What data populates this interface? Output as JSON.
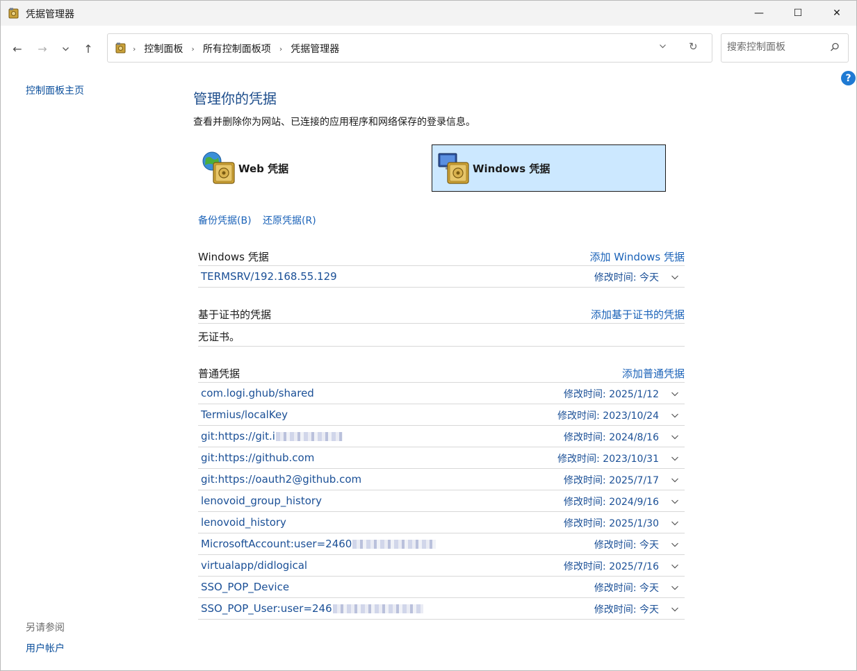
{
  "window": {
    "title": "凭据管理器",
    "buttons": {
      "minimize": "—",
      "maximize": "☐",
      "close": "✕"
    }
  },
  "nav": {
    "breadcrumb": [
      "控制面板",
      "所有控制面板项",
      "凭据管理器"
    ],
    "search_placeholder": "搜索控制面板"
  },
  "sidebar": {
    "home_link": "控制面板主页",
    "see_also_label": "另请参阅",
    "user_accounts_link": "用户帐户"
  },
  "main": {
    "title": "管理你的凭据",
    "description": "查看并删除你为网站、已连接的应用程序和网络保存的登录信息。",
    "tiles": {
      "web": "Web 凭据",
      "windows": "Windows 凭据"
    },
    "actions": {
      "backup": "备份凭据(B)",
      "restore": "还原凭据(R)"
    }
  },
  "sections": {
    "windows": {
      "title": "Windows 凭据",
      "add_link": "添加 Windows 凭据",
      "items": [
        {
          "name": "TERMSRV/192.168.55.129",
          "modified": "修改时间:  今天"
        }
      ]
    },
    "certificate": {
      "title": "基于证书的凭据",
      "add_link": "添加基于证书的凭据",
      "empty_text": "无证书。"
    },
    "generic": {
      "title": "普通凭据",
      "add_link": "添加普通凭据",
      "items": [
        {
          "name": "com.logi.ghub/shared",
          "modified": "修改时间:  2025/1/12"
        },
        {
          "name": "Termius/localKey",
          "modified": "修改时间:  2023/10/24"
        },
        {
          "name": "git:https://git.i",
          "modified": "修改时间:  2024/8/16"
        },
        {
          "name": "git:https://github.com",
          "modified": "修改时间:  2023/10/31"
        },
        {
          "name": "git:https://oauth2@github.com",
          "modified": "修改时间:  2025/7/17"
        },
        {
          "name": "lenovoid_group_history",
          "modified": "修改时间:  2024/9/16"
        },
        {
          "name": "lenovoid_history",
          "modified": "修改时间:  2025/1/30"
        },
        {
          "name": "MicrosoftAccount:user=2460",
          "modified": "修改时间:  今天"
        },
        {
          "name": "virtualapp/didlogical",
          "modified": "修改时间:  2025/7/16"
        },
        {
          "name": "SSO_POP_Device",
          "modified": "修改时间:  今天"
        },
        {
          "name": "SSO_POP_User:user=246",
          "modified": "修改时间:  今天"
        }
      ]
    }
  }
}
